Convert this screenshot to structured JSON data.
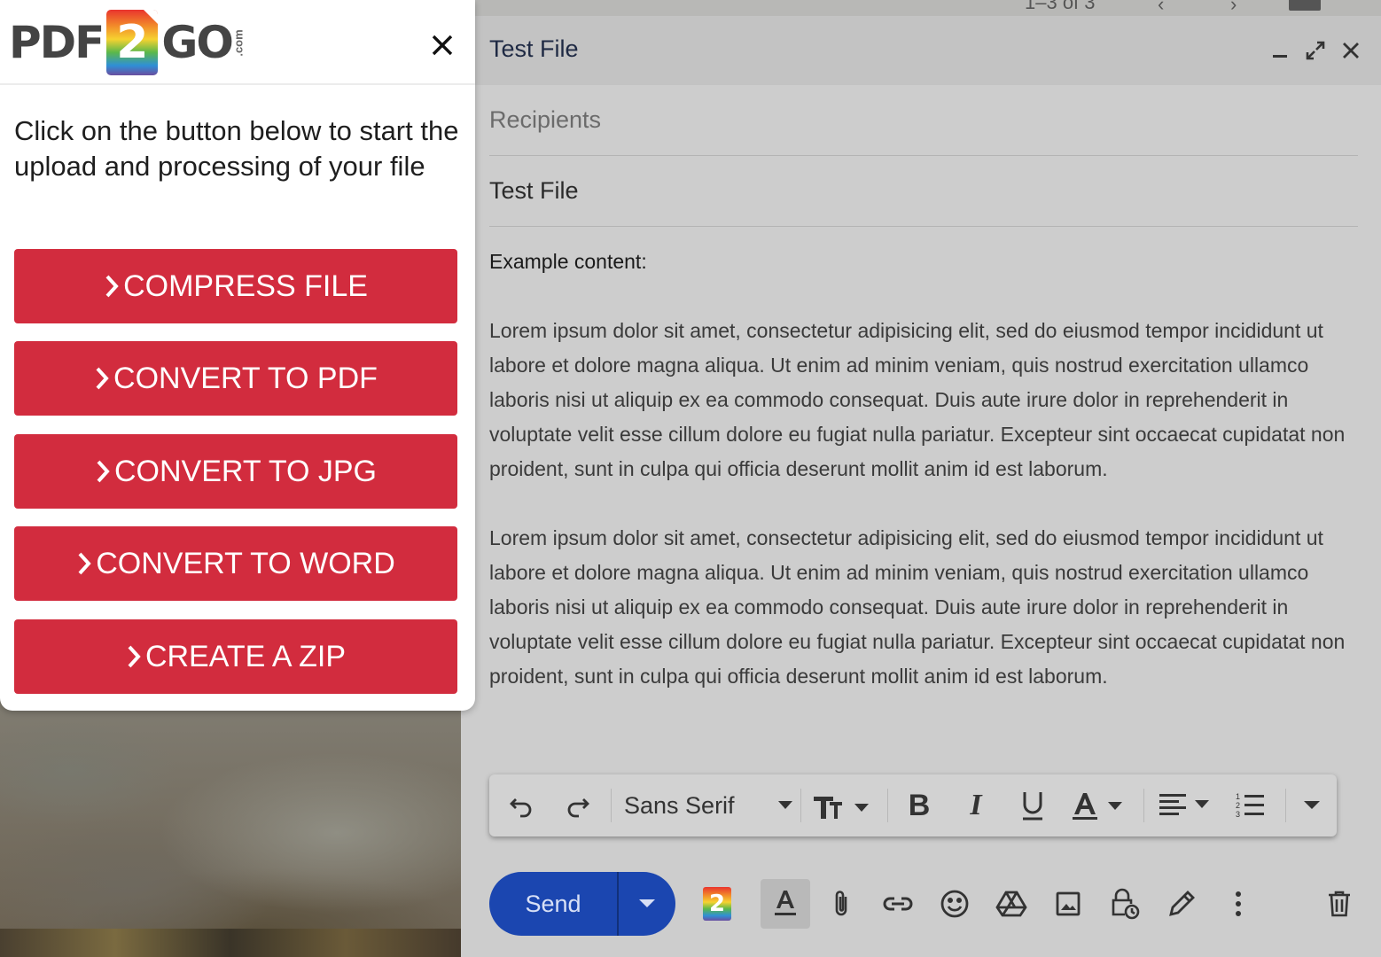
{
  "background": {
    "pager_text": "1–3 of 3"
  },
  "compose": {
    "title": "Test File",
    "recipients_placeholder": "Recipients",
    "subject": "Test File",
    "body_heading": "Example content:",
    "paragraphs": [
      "Lorem ipsum dolor sit amet, consectetur adipisicing elit, sed do eiusmod tempor incididunt ut labore et dolore magna aliqua. Ut enim ad minim veniam, quis nostrud exercitation ullamco laboris nisi ut aliquip ex ea commodo consequat. Duis aute irure dolor in reprehenderit in voluptate velit esse cillum dolore eu fugiat nulla pariatur. Excepteur sint occaecat cupidatat non proident, sunt in culpa qui officia deserunt mollit anim id est laborum.",
      "Lorem ipsum dolor sit amet, consectetur adipisicing elit, sed do eiusmod tempor incididunt ut labore et dolore magna aliqua. Ut enim ad minim veniam, quis nostrud exercitation ullamco laboris nisi ut aliquip ex ea commodo consequat. Duis aute irure dolor in reprehenderit in voluptate velit esse cillum dolore eu fugiat nulla pariatur. Excepteur sint occaecat cupidatat non proident, sunt in culpa qui officia deserunt mollit anim id est laborum."
    ],
    "toolbar": {
      "font_family": "Sans Serif"
    },
    "send_label": "Send",
    "addon_badge": "2"
  },
  "popup": {
    "logo_left": "PDF",
    "logo_mark": "2",
    "logo_right": "GO",
    "logo_suffix": ".com",
    "intro": "Click on the button below to start the upload and processing of your file",
    "buttons": [
      "COMPRESS FILE",
      "CONVERT TO PDF",
      "CONVERT TO JPG",
      "CONVERT TO WORD",
      "CREATE A ZIP"
    ]
  },
  "colors": {
    "accent_red": "#d22c3e",
    "send_blue": "#1b46b0"
  }
}
